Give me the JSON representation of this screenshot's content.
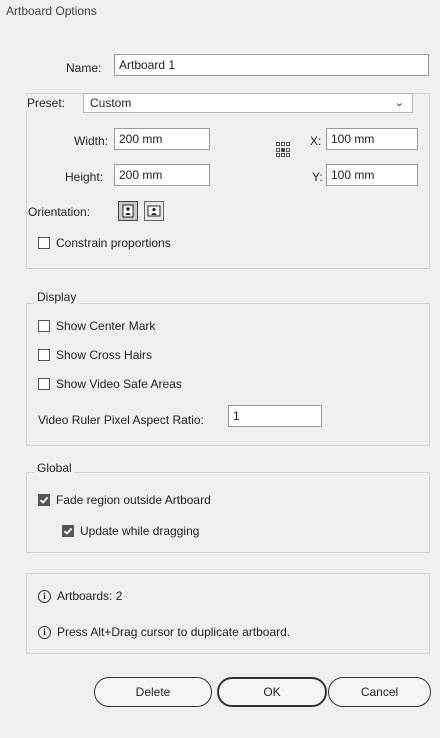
{
  "window": {
    "title": "Artboard Options"
  },
  "name_row": {
    "label": "Name:",
    "value": "Artboard 1"
  },
  "preset": {
    "label": "Preset:",
    "value": "Custom",
    "width_label": "Width:",
    "width_value": "200 mm",
    "height_label": "Height:",
    "height_value": "200 mm",
    "x_label": "X:",
    "x_value": "100 mm",
    "y_label": "Y:",
    "y_value": "100 mm",
    "orientation_label": "Orientation:",
    "orientation_active": "portrait",
    "constrain_label": "Constrain proportions",
    "constrain_checked": false
  },
  "display": {
    "legend": "Display",
    "items": [
      {
        "label": "Show Center Mark",
        "checked": false
      },
      {
        "label": "Show Cross Hairs",
        "checked": false
      },
      {
        "label": "Show Video Safe Areas",
        "checked": false
      }
    ],
    "ratio_label": "Video Ruler Pixel Aspect Ratio:",
    "ratio_value": "1"
  },
  "global": {
    "legend": "Global",
    "fade_label": "Fade region outside Artboard",
    "fade_checked": true,
    "update_label": "Update while dragging",
    "update_checked": true
  },
  "info": {
    "artboards": "Artboards: 2",
    "hint": "Press Alt+Drag cursor to duplicate artboard."
  },
  "buttons": {
    "delete": "Delete",
    "ok": "OK",
    "cancel": "Cancel"
  },
  "icons": {
    "info": "info-circle-icon",
    "chevron": "chevron-down-icon",
    "reference_point": "reference-point-grid-icon",
    "portrait": "portrait-orientation-icon",
    "landscape": "landscape-orientation-icon"
  }
}
